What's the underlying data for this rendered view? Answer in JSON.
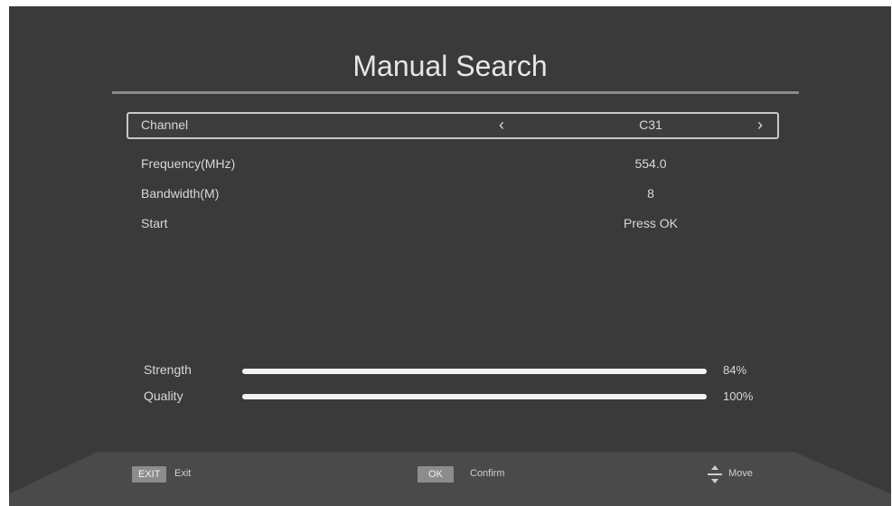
{
  "title": "Manual Search",
  "menu": [
    {
      "label": "Channel",
      "value": "C31",
      "selected": true
    },
    {
      "label": "Frequency(MHz)",
      "value": "554.0"
    },
    {
      "label": "Bandwidth(M)",
      "value": "8"
    },
    {
      "label": "Start",
      "value": "Press OK"
    }
  ],
  "arrows": {
    "left": "‹",
    "right": "›"
  },
  "meters": [
    {
      "label": "Strength",
      "percent_text": "84%",
      "level": 1.0
    },
    {
      "label": "Quality",
      "percent_text": "100%",
      "level": 1.0
    }
  ],
  "footer": {
    "exit_key": "EXIT",
    "exit_label": "Exit",
    "ok_key": "OK",
    "ok_label": "Confirm",
    "move_label": "Move",
    "move_icon": "move-arrows-icon"
  },
  "colors": {
    "background": "#3a3a3a",
    "text": "#d8d8d8",
    "meter_fill": "#f2f2f2",
    "key_bg": "#8c8c8c"
  }
}
